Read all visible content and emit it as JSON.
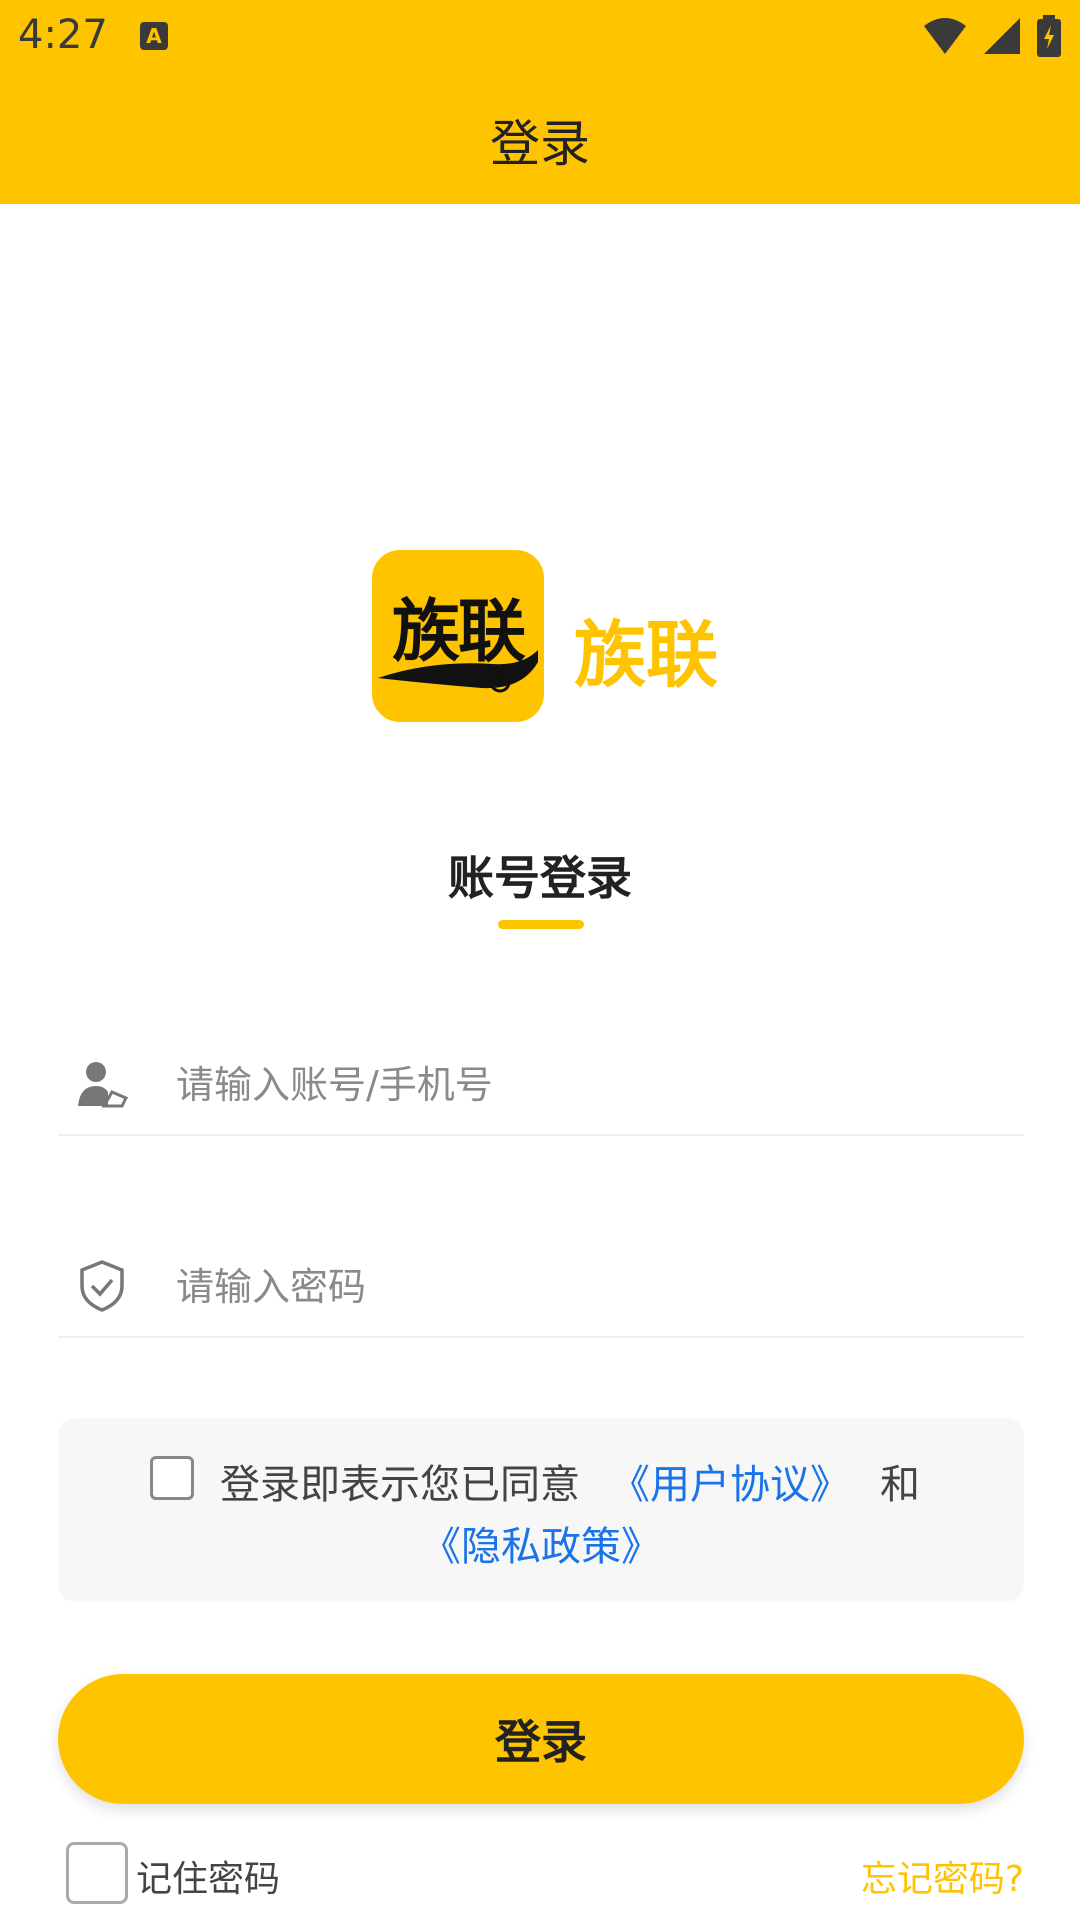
{
  "status_bar": {
    "time": "4:27",
    "icons": [
      "a-notification-icon",
      "wifi-icon",
      "signal-icon",
      "battery-charging-icon"
    ]
  },
  "header": {
    "title": "登录"
  },
  "branding": {
    "logo_text": "族联",
    "app_name": "族联"
  },
  "login_tab": {
    "label": "账号登录"
  },
  "form": {
    "account_placeholder": "请输入账号/手机号",
    "password_placeholder": "请输入密码"
  },
  "agreement": {
    "text": "登录即表示您已同意",
    "user_agreement": "《用户协议》",
    "and": "和",
    "privacy_policy": "《隐私政策》"
  },
  "login_button": "登录",
  "remember_password": "记住密码",
  "forgot_password": "忘记密码?",
  "colors": {
    "accent": "#FFC400",
    "link": "#1a73e8"
  }
}
